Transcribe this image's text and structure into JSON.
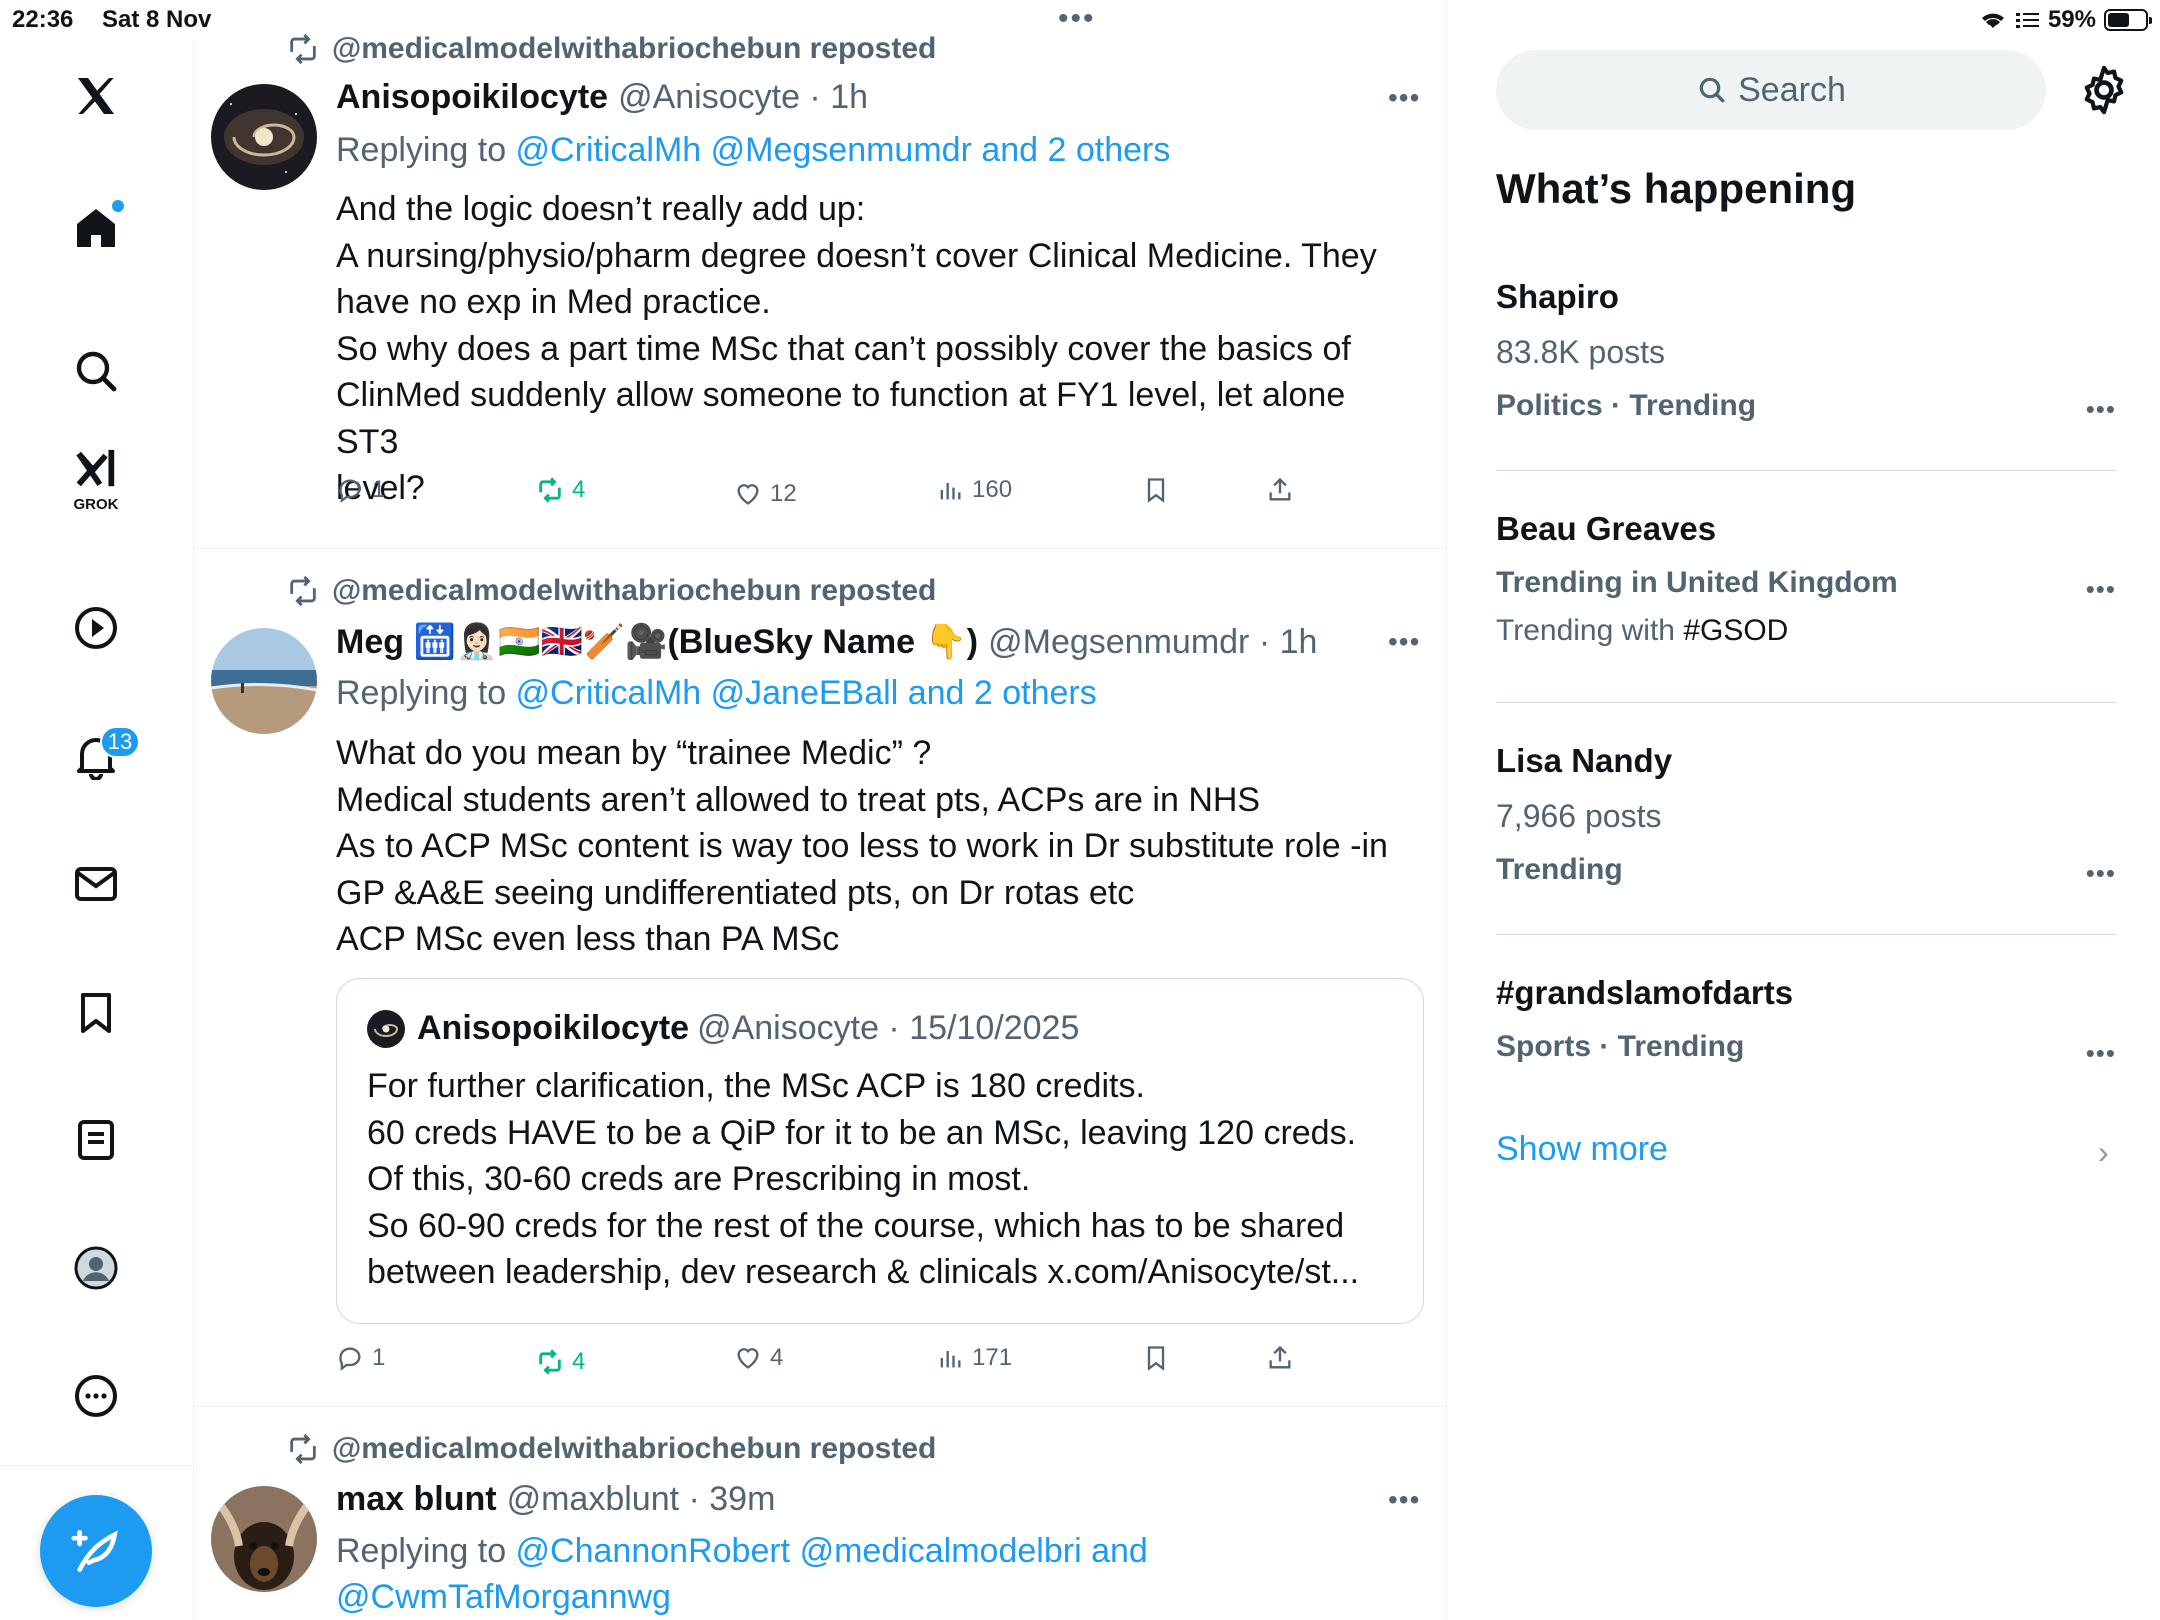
{
  "status_bar": {
    "time": "22:36",
    "date": "Sat 8 Nov",
    "battery": "59%",
    "battery_level": 0.59
  },
  "nav": {
    "items": [
      {
        "icon": "x-logo-icon"
      },
      {
        "icon": "home-icon",
        "has_dot": true
      },
      {
        "icon": "search-icon"
      },
      {
        "icon": "grok-icon",
        "label": "GROK"
      },
      {
        "icon": "play-icon"
      },
      {
        "icon": "bell-icon",
        "badge": "13"
      },
      {
        "icon": "mail-icon"
      },
      {
        "icon": "bookmark-icon"
      },
      {
        "icon": "list-icon"
      },
      {
        "icon": "profile-icon"
      },
      {
        "icon": "more-circle-icon"
      }
    ],
    "grok_label": "GROK",
    "notifications_badge": "13",
    "compose_icon": "compose-icon"
  },
  "feed": {
    "tweets": [
      {
        "repost_text": "@medicalmodelwithabriochebun reposted",
        "name": "Anisopoikilocyte",
        "meta": "@Anisocyte · 1h",
        "reply_prefix": "Replying to ",
        "reply_links": "@CriticalMh @Megsenmumdr and 2 others",
        "body_lines": [
          "And the logic doesn’t really add up:",
          "A nursing/physio/pharm degree doesn’t cover Clinical Medicine. They",
          "have no exp in Med practice.",
          "So why does a part time MSc that can’t possibly cover the basics of",
          "ClinMed suddenly allow someone to function at FY1 level, let alone ST3",
          "level?"
        ],
        "replies": "1",
        "reposts": "4",
        "likes": "12",
        "views": "160"
      },
      {
        "repost_text": "@medicalmodelwithabriochebun reposted",
        "name": "Meg 🛗👩🏻‍⚕️🇮🇳🇬🇧🏏🎥(BlueSky Name 👇)",
        "meta": "@Megsenmumdr · 1h",
        "reply_prefix": "Replying to ",
        "reply_links": "@CriticalMh @JaneEBall and 2 others",
        "body_lines": [
          "What do you mean by “trainee Medic” ?",
          "Medical students aren’t allowed to treat pts, ACPs are in NHS",
          "As to ACP MSc content is way too less to work in Dr substitute role -in",
          "GP &A&E seeing undifferentiated pts, on Dr rotas etc",
          "ACP MSc even less than PA MSc"
        ],
        "quote": {
          "name": "Anisopoikilocyte",
          "meta": "@Anisocyte · 15/10/2025",
          "body_lines": [
            "For further clarification, the MSc ACP is 180 credits.",
            "60 creds HAVE to be a QiP for it to be an MSc, leaving 120 creds.",
            "Of this, 30-60 creds are Prescribing in most.",
            "So 60-90 creds for the rest of the course, which has to be shared",
            "between leadership, dev research & clinicals x.com/Anisocyte/st..."
          ]
        },
        "replies": "1",
        "reposts": "4",
        "likes": "4",
        "views": "171"
      },
      {
        "repost_text": "@medicalmodelwithabriochebun reposted",
        "name": "max blunt",
        "meta": "@maxblunt · 39m",
        "reply_prefix": "Replying to ",
        "reply_links": "@ChannonRobert @medicalmodelbri and",
        "reply_links_2": "@CwmTafMorgannwg"
      }
    ]
  },
  "sidebar": {
    "search_placeholder": "Search",
    "title": "What’s happening",
    "trends": [
      {
        "name": "Shapiro",
        "posts": "83.8K posts",
        "context": "Politics · Trending"
      },
      {
        "name": "Beau Greaves",
        "context": "Trending in United Kingdom",
        "sub_prefix": "Trending with ",
        "sub_tag": "#GSOD"
      },
      {
        "name": "Lisa Nandy",
        "posts": "7,966 posts",
        "context": "Trending"
      },
      {
        "name": "#grandslamofdarts",
        "context": "Sports · Trending"
      }
    ],
    "show_more": "Show more"
  },
  "colors": {
    "accent": "#1d9bf0",
    "text": "#0f1419",
    "secondary": "#536471",
    "repost_green": "#00ba7c",
    "border": "#eff3f4"
  }
}
